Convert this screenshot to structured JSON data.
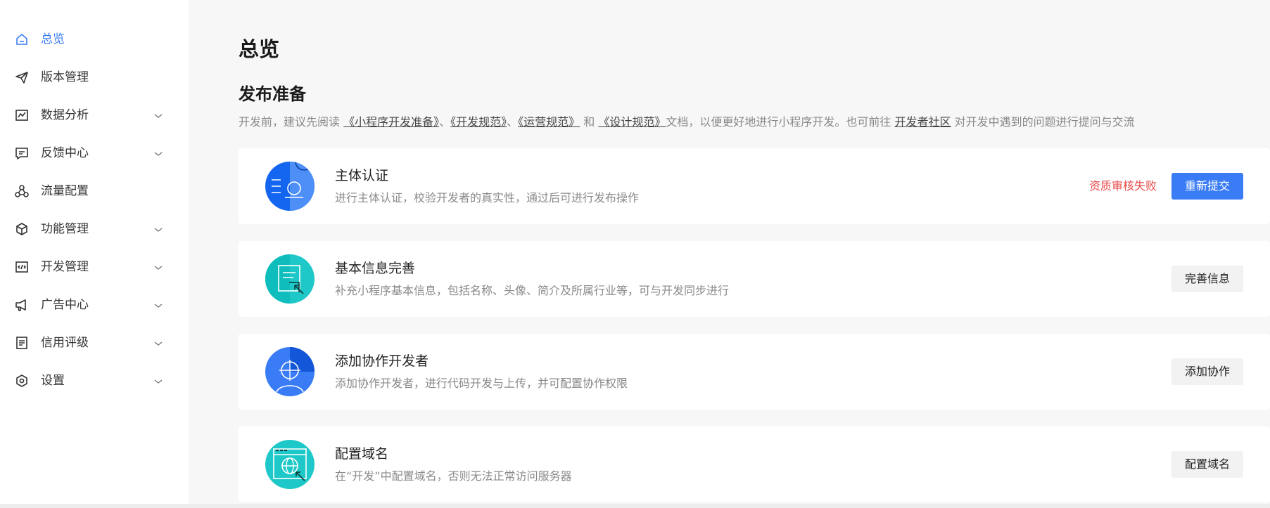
{
  "sidebar": {
    "items": [
      {
        "label": "总览",
        "icon": "home-icon",
        "active": true,
        "expandable": false
      },
      {
        "label": "版本管理",
        "icon": "send-icon",
        "active": false,
        "expandable": false
      },
      {
        "label": "数据分析",
        "icon": "chart-icon",
        "active": false,
        "expandable": true
      },
      {
        "label": "反馈中心",
        "icon": "message-icon",
        "active": false,
        "expandable": true
      },
      {
        "label": "流量配置",
        "icon": "nodes-icon",
        "active": false,
        "expandable": false
      },
      {
        "label": "功能管理",
        "icon": "cube-icon",
        "active": false,
        "expandable": true
      },
      {
        "label": "开发管理",
        "icon": "code-icon",
        "active": false,
        "expandable": true
      },
      {
        "label": "广告中心",
        "icon": "megaphone-icon",
        "active": false,
        "expandable": true
      },
      {
        "label": "信用评级",
        "icon": "list-icon",
        "active": false,
        "expandable": true
      },
      {
        "label": "设置",
        "icon": "settings-icon",
        "active": false,
        "expandable": true
      }
    ]
  },
  "main": {
    "page_title": "总览",
    "section_title": "发布准备",
    "intro": {
      "t1": "开发前，建议先阅读 ",
      "link1": "《小程序开发准备》",
      "t2": "、",
      "link2": "《开发规范》",
      "t3": "、",
      "link3": "《运营规范》",
      "t4": " 和 ",
      "link4": "《设计规范》",
      "t5": "文档，以便更好地进行小程序开发。也可前往 ",
      "link5": "开发者社区",
      "t6": " 对开发中遇到的问题进行提问与交流"
    },
    "cards": [
      {
        "title": "主体认证",
        "desc": "进行主体认证，校验开发者的真实性，通过后可进行发布操作",
        "status": "资质审核失败",
        "button": "重新提交",
        "icon": "id-card-icon"
      },
      {
        "title": "基本信息完善",
        "desc": "补充小程序基本信息，包括名称、头像、简介及所属行业等，可与开发同步进行",
        "button": "完善信息",
        "icon": "document-edit-icon"
      },
      {
        "title": "添加协作开发者",
        "desc": "添加协作开发者，进行代码开发与上传，并可配置协作权限",
        "button": "添加协作",
        "icon": "user-add-icon"
      },
      {
        "title": "配置域名",
        "desc": "在“开发”中配置域名，否则无法正常访问服务器",
        "button": "配置域名",
        "icon": "globe-window-icon"
      }
    ]
  },
  "colors": {
    "accent": "#3a7cf5",
    "error": "#e84a4a",
    "teal": "#1ec8c8"
  }
}
